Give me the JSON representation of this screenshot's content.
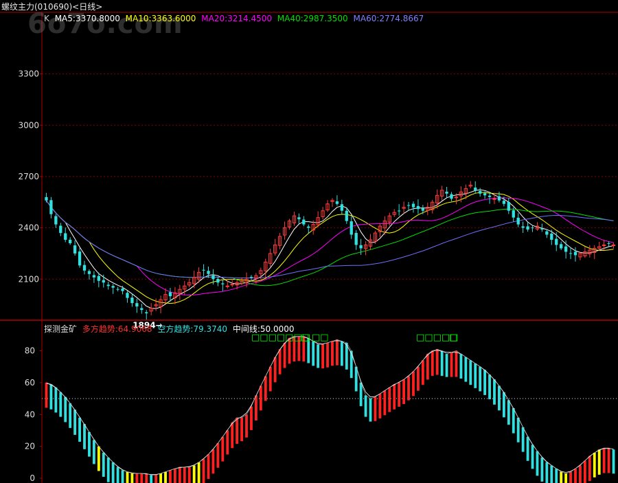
{
  "header": {
    "title": "螺纹主力(010690)<日线>",
    "watermark": "6o7o.com"
  },
  "colors": {
    "background": "#000000",
    "axis": "#b00000",
    "grid": "#8a0000",
    "up": "#ff3c3c",
    "down": "#33e0e0",
    "ma5": "#ffffff",
    "ma10": "#ffff00",
    "ma20": "#ff00ff",
    "ma40": "#00e000",
    "ma60": "#6f6fff",
    "bull_bar": "#ff2020",
    "bear_bar": "#30e0e0",
    "yellow_bar": "#ffff00",
    "signal_green": "#00ff00"
  },
  "main_legend": [
    {
      "text": "K",
      "color": "#cccccc"
    },
    {
      "text": "MA5:3370.8000",
      "color": "#ffffff"
    },
    {
      "text": "MA10:3363.6000",
      "color": "#ffff00"
    },
    {
      "text": "MA20:3214.4500",
      "color": "#ff00ff"
    },
    {
      "text": "MA40:2987.3500",
      "color": "#00e000"
    },
    {
      "text": "MA60:2774.8667",
      "color": "#8080ff"
    }
  ],
  "sub_legend": [
    {
      "text": "探测金矿",
      "color": "#dddddd"
    },
    {
      "text": "多方趋势:64.9068",
      "color": "#ff3030"
    },
    {
      "text": "空方趋势:79.3740",
      "color": "#30e0e0"
    },
    {
      "text": "中间线:50.0000",
      "color": "#ffffff"
    }
  ],
  "low_label": "1894→",
  "chart_data": [
    {
      "type": "candlestick",
      "title": "螺纹主力(010690)<日线>",
      "y_ticks": [
        2100,
        2400,
        2700,
        3000,
        3300
      ],
      "ylim": [
        1860,
        3660
      ],
      "grid": true,
      "annotation": {
        "text": "1894→",
        "value": 1894
      },
      "closes": [
        2560,
        2480,
        2420,
        2370,
        2330,
        2310,
        2250,
        2180,
        2150,
        2130,
        2110,
        2090,
        2080,
        2060,
        2050,
        2040,
        2030,
        1990,
        1960,
        1940,
        1920,
        1900,
        1930,
        1950,
        1980,
        2010,
        2000,
        2020,
        2040,
        2060,
        2080,
        2110,
        2140,
        2150,
        2130,
        2100,
        2080,
        2070,
        2060,
        2070,
        2080,
        2090,
        2100,
        2110,
        2120,
        2150,
        2200,
        2250,
        2300,
        2350,
        2400,
        2440,
        2470,
        2450,
        2420,
        2400,
        2420,
        2460,
        2500,
        2540,
        2560,
        2540,
        2500,
        2440,
        2360,
        2300,
        2280,
        2300,
        2330,
        2370,
        2410,
        2440,
        2470,
        2490,
        2500,
        2520,
        2530,
        2520,
        2510,
        2500,
        2520,
        2550,
        2590,
        2620,
        2600,
        2570,
        2580,
        2610,
        2630,
        2650,
        2620,
        2600,
        2590,
        2580,
        2570,
        2560,
        2540,
        2500,
        2460,
        2420,
        2400,
        2390,
        2400,
        2410,
        2390,
        2360,
        2330,
        2300,
        2280,
        2260,
        2250,
        2240,
        2250,
        2260,
        2270,
        2280,
        2290,
        2300,
        2310,
        2300
      ],
      "ma5_last": 3370.8,
      "ma10_last": 3363.6,
      "ma20_last": 3214.45,
      "ma40_last": 2987.35,
      "ma60_last": 2774.8667
    },
    {
      "type": "bar",
      "title": "探测金矿",
      "y_ticks": [
        0,
        20,
        40,
        60,
        80
      ],
      "ylim": [
        -3,
        91
      ],
      "midline": 50,
      "signals": [
        "□□□□□□□",
        "□",
        "□□",
        "□□□□□",
        "□"
      ],
      "values": [
        60,
        59,
        57,
        54,
        51,
        47,
        43,
        38,
        34,
        29,
        24,
        20,
        16,
        13,
        10,
        7,
        5,
        4,
        3,
        3,
        3,
        3,
        2,
        2,
        3,
        4,
        5,
        6,
        7,
        7,
        7,
        8,
        10,
        12,
        15,
        18,
        22,
        26,
        30,
        35,
        38,
        38,
        40,
        45,
        52,
        58,
        64,
        70,
        76,
        81,
        85,
        88,
        89,
        89,
        89,
        88,
        86,
        84,
        84,
        85,
        86,
        87,
        86,
        85,
        80,
        70,
        60,
        52,
        50,
        51,
        53,
        55,
        57,
        59,
        60,
        62,
        64,
        67,
        70,
        74,
        78,
        80,
        81,
        80,
        78,
        79,
        80,
        78,
        76,
        74,
        72,
        70,
        68,
        65,
        62,
        58,
        54,
        49,
        44,
        38,
        32,
        26,
        21,
        17,
        13,
        10,
        8,
        6,
        4,
        3,
        4,
        6,
        8,
        11,
        14,
        16,
        18,
        19,
        19,
        18
      ]
    }
  ]
}
